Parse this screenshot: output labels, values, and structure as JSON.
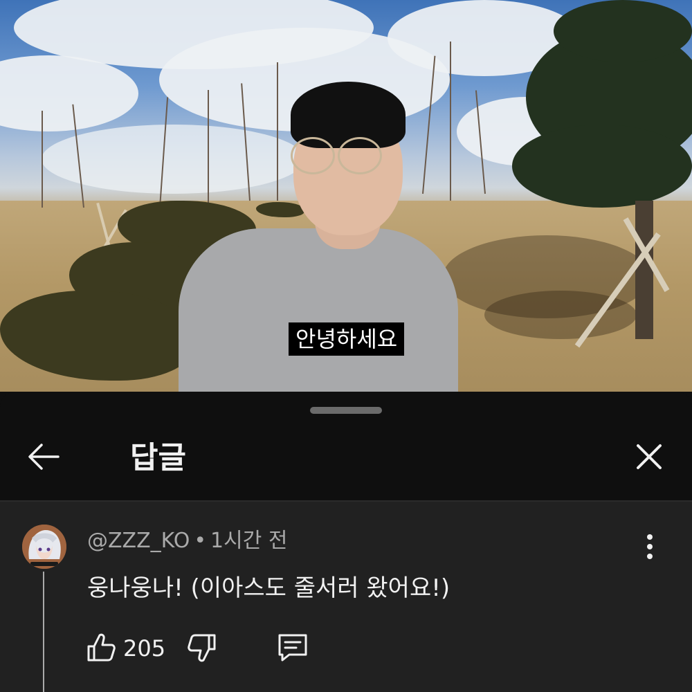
{
  "video": {
    "subtitle": "안녕하세요"
  },
  "sheet": {
    "title": "답글",
    "back_icon": "arrow-left-icon",
    "close_icon": "close-icon"
  },
  "comment": {
    "author": "@ZZZ_KO",
    "separator": "•",
    "time": "1시간 전",
    "text": "웅나웅나! (이아스도 줄서러 왔어요!)",
    "likes": "205",
    "like_icon": "thumbs-up-icon",
    "dislike_icon": "thumbs-down-icon",
    "reply_icon": "reply-comment-icon",
    "more_icon": "more-vert-icon"
  },
  "colors": {
    "sheet_bg": "#0f0f0f",
    "comment_bg": "#212121",
    "text_primary": "#f1f1f1",
    "text_secondary": "#aaaaaa"
  }
}
